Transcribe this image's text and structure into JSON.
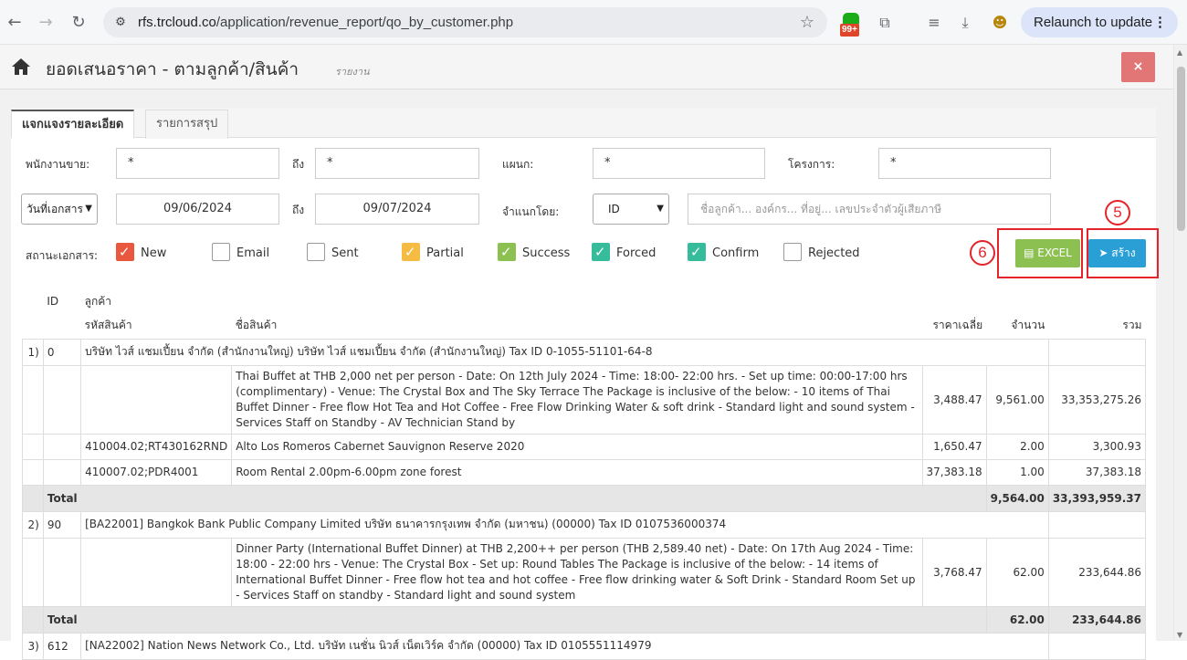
{
  "browser": {
    "url_host": "rfs.trcloud.co",
    "url_path": "/application/revenue_report/qo_by_customer.php",
    "ext_badge": "99+",
    "relaunch_label": "Relaunch to update"
  },
  "header": {
    "title": "ยอดเสนอราคา - ตามลูกค้า/สินค้า",
    "subtitle": "รายงาน",
    "close_label": "×"
  },
  "tabs": {
    "detail": "แจกแจงรายละเอียด",
    "summary": "รายการสรุป"
  },
  "filters": {
    "salesperson_label": "พนักงานขาย:",
    "salesperson_from": "*",
    "to_label": "ถึง",
    "salesperson_to": "*",
    "department_label": "แผนก:",
    "department": "*",
    "project_label": "โครงการ:",
    "project": "*",
    "date_type": "วันที่เอกสาร",
    "date_from": "09/06/2024",
    "date_to": "09/07/2024",
    "classify_label": "จำแนกโดย:",
    "classify_value": "ID",
    "search_placeholder": "ชื่อลูกค้า... องค์กร... ที่อยู่... เลขประจำตัวผู้เสียภาษี",
    "status_label": "สถานะเอกสาร:"
  },
  "statuses": [
    {
      "label": "New",
      "checked": true,
      "color": "#e9573f"
    },
    {
      "label": "Email",
      "checked": false,
      "color": "#ffffff"
    },
    {
      "label": "Sent",
      "checked": false,
      "color": "#ffffff"
    },
    {
      "label": "Partial",
      "checked": true,
      "color": "#f6bb42"
    },
    {
      "label": "Success",
      "checked": true,
      "color": "#8cc152"
    },
    {
      "label": "Forced",
      "checked": true,
      "color": "#37bc9b"
    },
    {
      "label": "Confirm",
      "checked": true,
      "color": "#37bc9b"
    },
    {
      "label": "Rejected",
      "checked": false,
      "color": "#ffffff"
    }
  ],
  "buttons": {
    "excel": "EXCEL",
    "create": "สร้าง",
    "annot_5": "5",
    "annot_6": "6"
  },
  "table": {
    "h_id": "ID",
    "h_customer": "ลูกค้า",
    "h_code": "รหัสสินค้า",
    "h_name": "ชื่อสินค้า",
    "h_avg": "ราคาเฉลี่ย",
    "h_qty": "จำนวน",
    "h_total": "รวม",
    "groups": [
      {
        "idx": "1)",
        "id": "0",
        "customer": "บริษัท ไวส์ แชมเปี้ยน จำกัด (สำนักงานใหญ่) บริษัท ไวส์ แชมเปี้ยน จำกัด (สำนักงานใหญ่) Tax ID 0-1055-51101-64-8",
        "items": [
          {
            "code": "",
            "name": "Thai Buffet at THB 2,000 net per person - Date: On 12th July 2024 - Time: 18:00- 22:00 hrs. - Set up time: 00:00-17:00 hrs (complimentary) - Venue: The Crystal Box and The Sky Terrace The Package is inclusive of the below: - 10 items of Thai Buffet Dinner - Free flow Hot Tea and Hot Coffee - Free Flow Drinking Water & soft drink - Standard light and sound system - Services Staff on Standby - AV Technician Stand by",
            "avg": "3,488.47",
            "qty": "9,561.00",
            "total": "33,353,275.26"
          },
          {
            "code": "410004.02;RT430162RND",
            "name": "Alto Los Romeros Cabernet Sauvignon Reserve 2020",
            "avg": "1,650.47",
            "qty": "2.00",
            "total": "3,300.93"
          },
          {
            "code": "410007.02;PDR4001",
            "name": "Room Rental 2.00pm-6.00pm zone forest",
            "avg": "37,383.18",
            "qty": "1.00",
            "total": "37,383.18"
          }
        ],
        "total_label": "Total",
        "total_qty": "9,564.00",
        "total_sum": "33,393,959.37"
      },
      {
        "idx": "2)",
        "id": "90",
        "customer": "[BA22001] Bangkok Bank Public Company Limited บริษัท ธนาคารกรุงเทพ จำกัด (มหาชน) (00000) Tax ID 0107536000374",
        "items": [
          {
            "code": "",
            "name": "Dinner Party (International Buffet Dinner) at THB 2,200++ per person (THB 2,589.40 net) - Date: On 17th Aug 2024 - Time: 18:00 - 22:00 hrs - Venue: The Crystal Box - Set up: Round Tables The Package is inclusive of the below: - 14 items of International Buffet Dinner - Free flow hot tea and hot coffee - Free flow drinking water & Soft Drink - Standard Room Set up - Services Staff on standby - Standard light and sound system",
            "avg": "3,768.47",
            "qty": "62.00",
            "total": "233,644.86"
          }
        ],
        "total_label": "Total",
        "total_qty": "62.00",
        "total_sum": "233,644.86"
      },
      {
        "idx": "3)",
        "id": "612",
        "customer": "[NA22002] Nation News Network Co., Ltd. บริษัท เนชั่น นิวส์ เน็ตเวิร์ค จำกัด (00000) Tax ID 0105551114979"
      }
    ]
  }
}
